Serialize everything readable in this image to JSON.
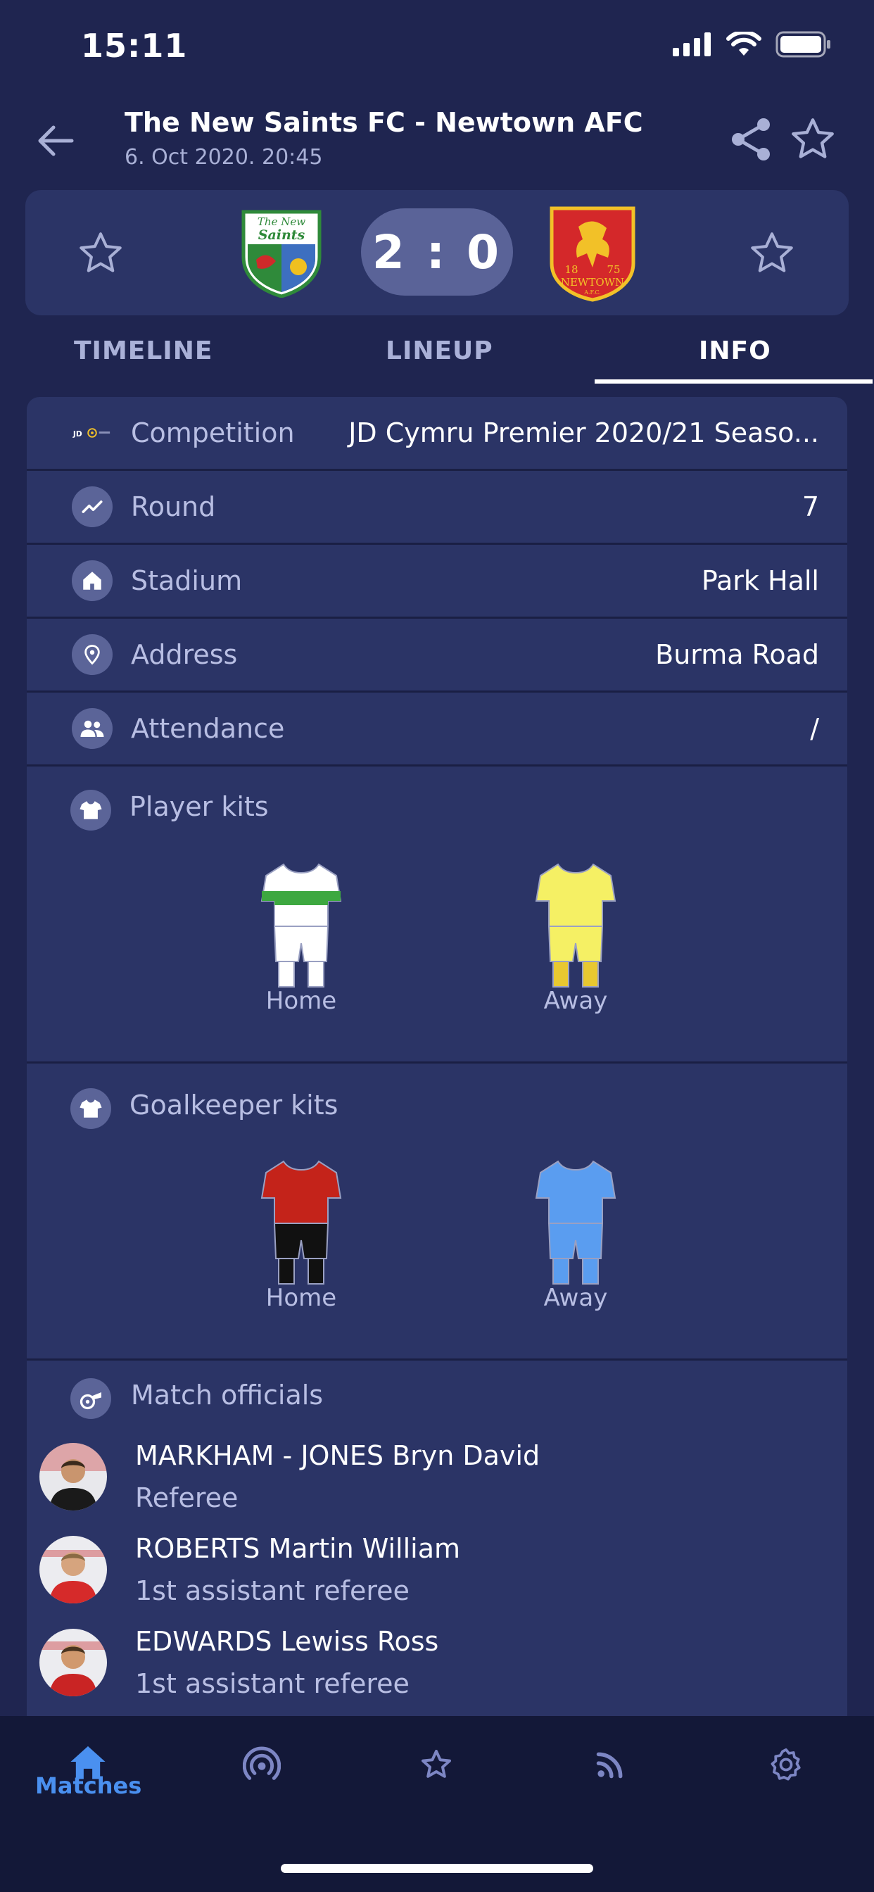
{
  "status_bar": {
    "time": "15:11"
  },
  "header": {
    "title": "The New Saints FC - Newtown AFC",
    "date": "6. Oct 2020. 20:45"
  },
  "score": {
    "home": "2",
    "away": "0",
    "display": "2 : 0"
  },
  "crests": {
    "home_line1": "The New",
    "home_line2": "Saints",
    "away_year_left": "18",
    "away_year_right": "75",
    "away_name": "NEWTOWN",
    "away_sub": "A.F.C."
  },
  "tabs": [
    {
      "label": "TIMELINE",
      "active": false
    },
    {
      "label": "LINEUP",
      "active": false
    },
    {
      "label": "INFO",
      "active": true
    }
  ],
  "info": {
    "rows": [
      {
        "label": "Competition",
        "value": "JD Cymru Premier 2020/21 Seaso...",
        "icon": "competition-logo-icon"
      },
      {
        "label": "Round",
        "value": "7",
        "icon": "trend-icon"
      },
      {
        "label": "Stadium",
        "value": "Park Hall",
        "icon": "home-icon"
      },
      {
        "label": "Address",
        "value": "Burma Road",
        "icon": "location-pin-icon"
      },
      {
        "label": "Attendance",
        "value": "/",
        "icon": "people-icon"
      }
    ],
    "player_kits": {
      "title": "Player kits",
      "home_label": "Home",
      "away_label": "Away",
      "home_colors": {
        "shirt": "#ffffff",
        "stripe": "#3da840",
        "shorts": "#ffffff",
        "socks": "#ffffff"
      },
      "away_colors": {
        "shirt": "#f5f064",
        "shorts": "#f5f064",
        "socks": "#e8c830"
      }
    },
    "goalkeeper_kits": {
      "title": "Goalkeeper kits",
      "home_label": "Home",
      "away_label": "Away",
      "home_colors": {
        "shirt": "#c4231a",
        "shorts": "#111111",
        "socks": "#111111"
      },
      "away_colors": {
        "shirt": "#5a9df0",
        "shorts": "#5a9df0",
        "socks": "#5a9df0"
      }
    },
    "officials": {
      "title": "Match officials",
      "list": [
        {
          "name": "MARKHAM - JONES Bryn David",
          "role": "Referee"
        },
        {
          "name": "ROBERTS Martin William",
          "role": "1st assistant referee"
        },
        {
          "name": "EDWARDS Lewiss Ross",
          "role": "1st assistant referee"
        }
      ]
    }
  },
  "bottom_nav": {
    "items": [
      {
        "label": "Matches",
        "icon": "home-icon",
        "active": true
      },
      {
        "icon": "live-broadcast-icon"
      },
      {
        "icon": "star-icon"
      },
      {
        "icon": "rss-feed-icon"
      },
      {
        "icon": "gear-icon"
      }
    ]
  },
  "colors": {
    "background": "#1f2550",
    "card": "#2b3466",
    "accent_blue": "#4a90f0",
    "score_pill": "#5a6398"
  }
}
